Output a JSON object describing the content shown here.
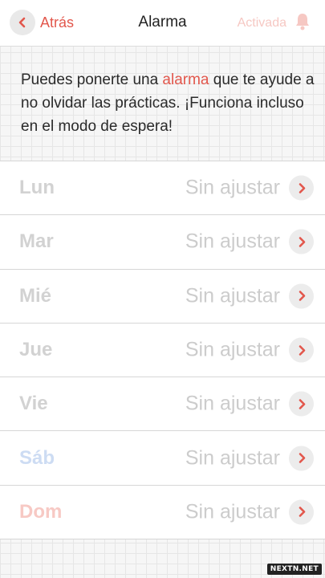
{
  "header": {
    "back_label": "Atrás",
    "title": "Alarma",
    "status_label": "Activada"
  },
  "intro": {
    "before": "Puedes ponerte una ",
    "highlight": "alarma",
    "after": " que te ayude a no olvidar las prácticas. ¡Funciona incluso en el modo de espera!"
  },
  "days": [
    {
      "name": "Lun",
      "value": "Sin ajustar",
      "color": "#d2d2d2"
    },
    {
      "name": "Mar",
      "value": "Sin ajustar",
      "color": "#d2d2d2"
    },
    {
      "name": "Mié",
      "value": "Sin ajustar",
      "color": "#d2d2d2"
    },
    {
      "name": "Jue",
      "value": "Sin ajustar",
      "color": "#d2d2d2"
    },
    {
      "name": "Vie",
      "value": "Sin ajustar",
      "color": "#d2d2d2"
    },
    {
      "name": "Sáb",
      "value": "Sin ajustar",
      "color": "#cddcf3"
    },
    {
      "name": "Dom",
      "value": "Sin ajustar",
      "color": "#f7c9c4"
    }
  ],
  "watermark": "NEXTN.NET",
  "colors": {
    "accent": "#e2574c",
    "status_inactive": "#f6c8c3"
  },
  "icons": {
    "back": "chevron-left-icon",
    "status": "bell-icon",
    "row": "chevron-right-icon"
  }
}
